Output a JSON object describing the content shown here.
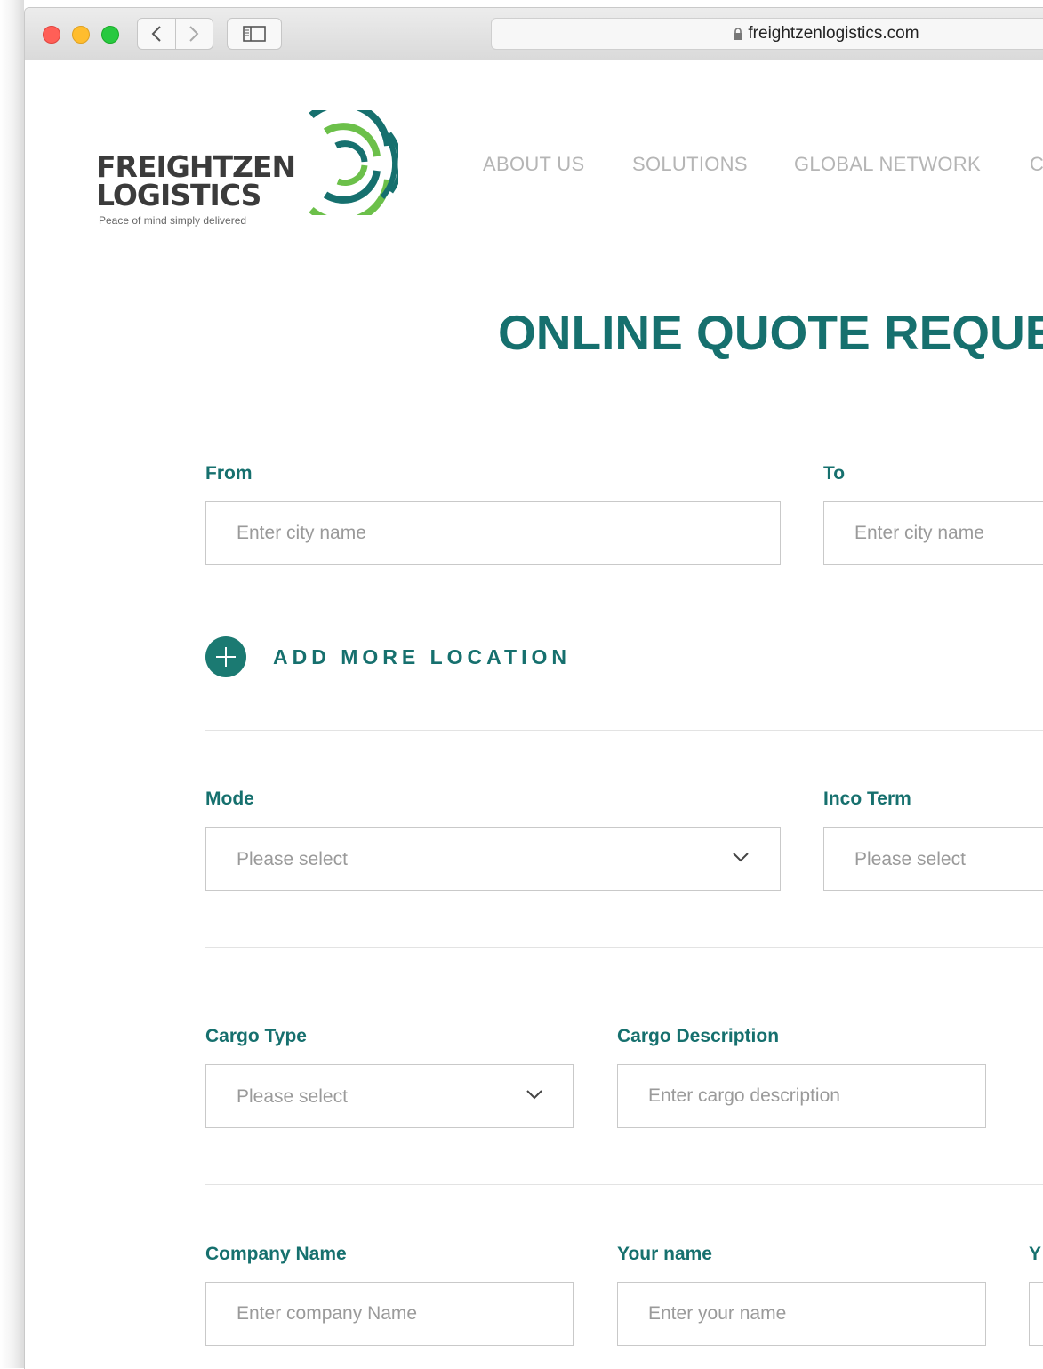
{
  "browser": {
    "url": "freightzenlogistics.com"
  },
  "logo": {
    "line1": "FREIGHTZEN",
    "line2": "LOGISTICS",
    "tagline": "Peace of mind simply delivered"
  },
  "nav": {
    "items": [
      "ABOUT US",
      "SOLUTIONS",
      "GLOBAL NETWORK",
      "C"
    ]
  },
  "page": {
    "title": "ONLINE QUOTE REQUE"
  },
  "form": {
    "from": {
      "label": "From",
      "placeholder": "Enter city name"
    },
    "to": {
      "label": "To",
      "placeholder": "Enter city name"
    },
    "add_location": "ADD MORE LOCATION",
    "mode": {
      "label": "Mode",
      "value": "Please select"
    },
    "inco_term": {
      "label": "Inco Term",
      "value": "Please select"
    },
    "cargo_type": {
      "label": "Cargo Type",
      "value": "Please select"
    },
    "cargo_description": {
      "label": "Cargo Description",
      "placeholder": "Enter cargo description"
    },
    "company_name": {
      "label": "Company Name",
      "placeholder": "Enter company Name"
    },
    "your_name": {
      "label": "Your name",
      "placeholder": "Enter your name"
    },
    "third_col_label": "Y"
  },
  "colors": {
    "brand_teal": "#16706e",
    "brand_green": "#6cc04a",
    "nav_gray": "#b5b5b5"
  }
}
